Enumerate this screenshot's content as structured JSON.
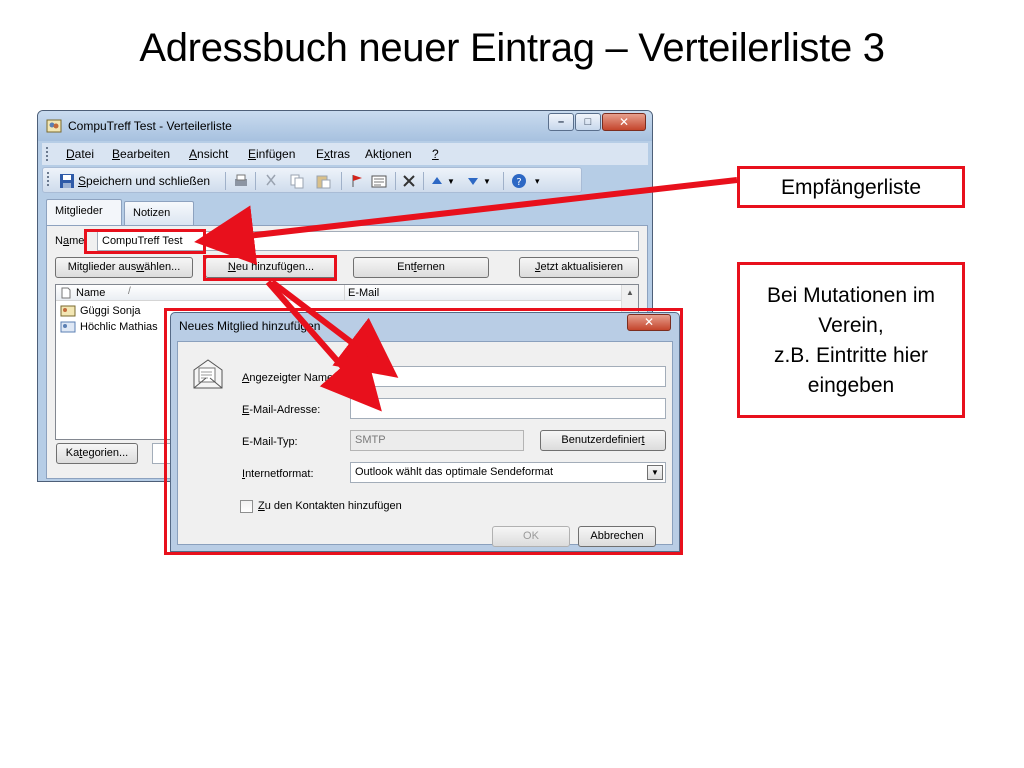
{
  "slide": {
    "title": "Adressbuch neuer Eintrag – Verteilerliste 3"
  },
  "main_window": {
    "title": "CompuTreff Test - Verteilerliste",
    "caption_buttons": {
      "minimize": "–",
      "maximize": "□",
      "close": "✕"
    },
    "menu": [
      {
        "pre": "",
        "ul": "D",
        "post": "atei"
      },
      {
        "pre": "",
        "ul": "B",
        "post": "earbeiten"
      },
      {
        "pre": "",
        "ul": "A",
        "post": "nsicht"
      },
      {
        "pre": "",
        "ul": "E",
        "post": "infügen"
      },
      {
        "pre": "E",
        "ul": "x",
        "post": "tras"
      },
      {
        "pre": "Akt",
        "ul": "i",
        "post": "onen"
      },
      {
        "pre": "",
        "ul": "?",
        "post": ""
      }
    ],
    "toolbar": {
      "save_close_ul": "S",
      "save_close_rest": "peichern und schließen"
    },
    "tabs": {
      "members": "Mitglieder",
      "notes": "Notizen"
    },
    "name_label_pre": "N",
    "name_label_ul": "a",
    "name_label_post": "me",
    "name_value": "CompuTreff Test",
    "buttons": {
      "select_members_pre": "Mitglieder aus",
      "select_members_ul": "w",
      "select_members_post": "ählen...",
      "add_new_ul": "N",
      "add_new_rest": "eu hinzufügen...",
      "remove_pre": "Ent",
      "remove_ul": "f",
      "remove_post": "ernen",
      "update_ul": "J",
      "update_rest": "etzt aktualisieren",
      "categories_pre": "Ka",
      "categories_ul": "t",
      "categories_post": "egorien..."
    },
    "list": {
      "col_name": "Name",
      "col_sort_marker": "/",
      "col_email": "E-Mail",
      "rows": [
        {
          "name": "Güggi Sonja"
        },
        {
          "name": "Höchlic Mathias"
        }
      ]
    }
  },
  "dialog": {
    "title": "Neues Mitglied hinzufügen",
    "close": "✕",
    "display_name_label_ul": "A",
    "display_name_label_rest": "ngezeigter Name:",
    "display_name_value": "",
    "email_label_pre": "",
    "email_label_ul": "E",
    "email_label_post": "-Mail-Adresse:",
    "email_value": "",
    "email_type_label": "E-Mail-Typ:",
    "email_type_value": "SMTP",
    "custom_button_pre": "Benutzerdefinier",
    "custom_button_ul": "t",
    "custom_button_post": "",
    "internet_format_label_ul": "I",
    "internet_format_label_rest": "nternetformat:",
    "internet_format_value": "Outlook wählt das optimale Sendeformat",
    "add_to_contacts_ul": "Z",
    "add_to_contacts_rest": "u den Kontakten hinzufügen",
    "ok": "OK",
    "cancel": "Abbrechen"
  },
  "callouts": {
    "recipients": "Empfängerliste",
    "mutations": [
      "Bei Mutationen im",
      "Verein,",
      "z.B. Eintritte  hier",
      "eingeben"
    ]
  },
  "colors": {
    "annotation_red": "#e8101c",
    "window_frame": "#b6cde6"
  }
}
